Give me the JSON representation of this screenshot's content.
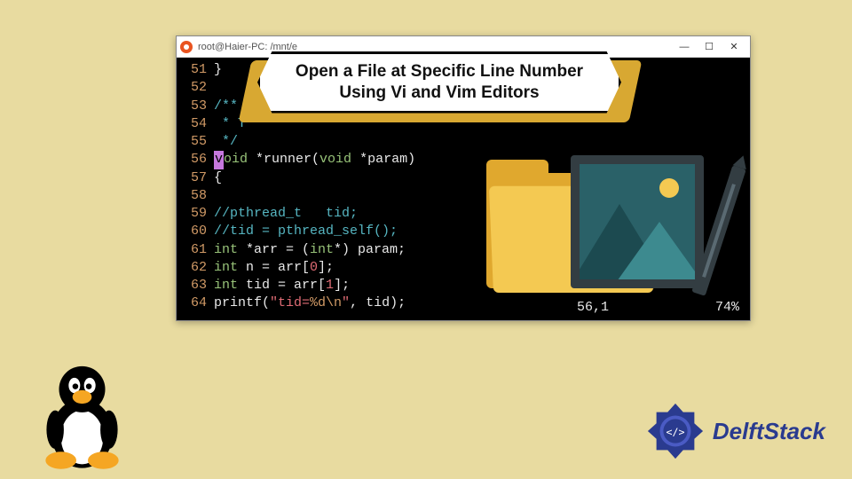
{
  "window": {
    "title": "root@Haier-PC: /mnt/e",
    "controls": {
      "min": "—",
      "max": "☐",
      "close": "✕"
    }
  },
  "code": {
    "lines": [
      {
        "n": "51",
        "tokens": [
          {
            "t": "}",
            "c": "c-white"
          }
        ]
      },
      {
        "n": "52",
        "tokens": []
      },
      {
        "n": "53",
        "tokens": [
          {
            "t": "/**",
            "c": "c-cyan"
          }
        ]
      },
      {
        "n": "54",
        "tokens": [
          {
            "t": " * T",
            "c": "c-cyan"
          }
        ]
      },
      {
        "n": "55",
        "tokens": [
          {
            "t": " */",
            "c": "c-cyan"
          }
        ]
      },
      {
        "n": "56",
        "tokens": [
          {
            "t": "v",
            "c": "cursor-block"
          },
          {
            "t": "oid",
            "c": "c-green"
          },
          {
            "t": " *runner(",
            "c": "c-white"
          },
          {
            "t": "void",
            "c": "c-green"
          },
          {
            "t": " *param)",
            "c": "c-white"
          }
        ]
      },
      {
        "n": "57",
        "tokens": [
          {
            "t": "{",
            "c": "c-white"
          }
        ]
      },
      {
        "n": "58",
        "tokens": []
      },
      {
        "n": "59",
        "tokens": [
          {
            "t": "//pthread_t   tid;",
            "c": "c-cyan"
          }
        ]
      },
      {
        "n": "60",
        "tokens": [
          {
            "t": "//tid = pthread_self();",
            "c": "c-cyan"
          }
        ]
      },
      {
        "n": "61",
        "tokens": [
          {
            "t": "int",
            "c": "c-green"
          },
          {
            "t": " *arr = (",
            "c": "c-white"
          },
          {
            "t": "int",
            "c": "c-green"
          },
          {
            "t": "*) param;",
            "c": "c-white"
          }
        ]
      },
      {
        "n": "62",
        "tokens": [
          {
            "t": "int",
            "c": "c-green"
          },
          {
            "t": " n = arr[",
            "c": "c-white"
          },
          {
            "t": "0",
            "c": "c-red"
          },
          {
            "t": "];",
            "c": "c-white"
          }
        ]
      },
      {
        "n": "63",
        "tokens": [
          {
            "t": "int",
            "c": "c-green"
          },
          {
            "t": " tid = arr[",
            "c": "c-white"
          },
          {
            "t": "1",
            "c": "c-red"
          },
          {
            "t": "];",
            "c": "c-white"
          }
        ]
      },
      {
        "n": "64",
        "tokens": [
          {
            "t": "printf(",
            "c": "c-white"
          },
          {
            "t": "\"tid=",
            "c": "c-red"
          },
          {
            "t": "%d\\n",
            "c": "c-orange"
          },
          {
            "t": "\"",
            "c": "c-red"
          },
          {
            "t": ", tid);",
            "c": "c-white"
          }
        ]
      }
    ]
  },
  "status": {
    "pos": "56,1",
    "pct": "74%"
  },
  "banner": {
    "line1": "Open a File at Specific Line Number",
    "line2": "Using Vi and Vim Editors"
  },
  "logo": {
    "text": "DelftStack"
  },
  "colors": {
    "bg": "#e8dba0",
    "terminal": "#000",
    "accent": "#d8a832",
    "brand": "#2a3b8f"
  }
}
